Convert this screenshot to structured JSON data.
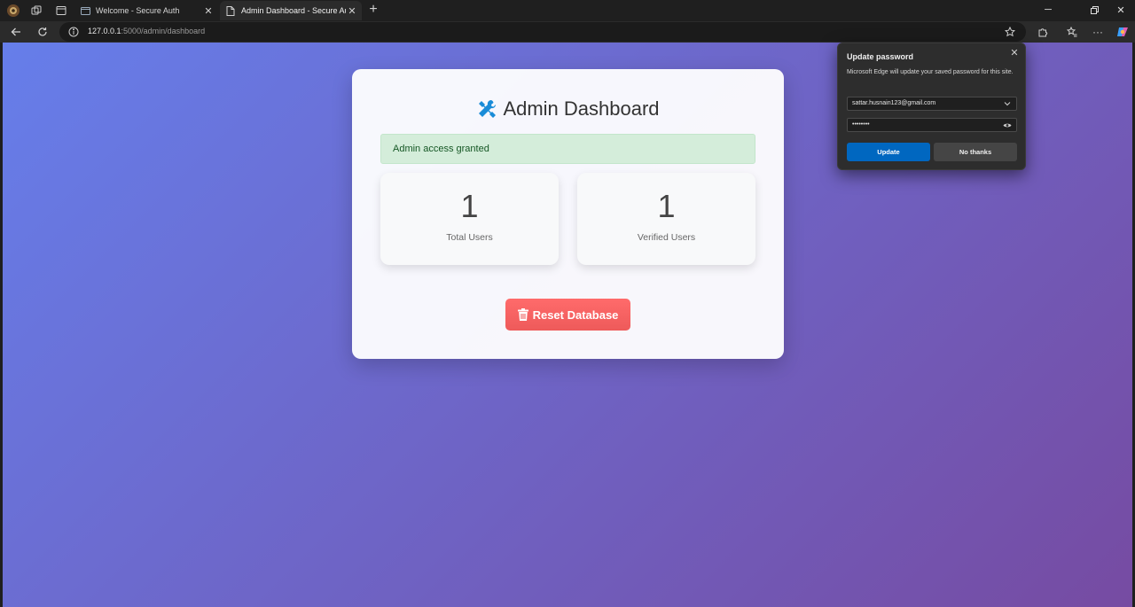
{
  "browser": {
    "tabs": [
      {
        "title": "Welcome - Secure Auth",
        "active": false
      },
      {
        "title": "Admin Dashboard - Secure Auth",
        "active": true
      }
    ],
    "url": {
      "host": "127.0.0.1",
      "rest": ":5000/admin/dashboard"
    }
  },
  "page": {
    "title": "Admin Dashboard",
    "alert": "Admin access granted",
    "stats": [
      {
        "value": "1",
        "label": "Total Users"
      },
      {
        "value": "1",
        "label": "Verified Users"
      }
    ],
    "reset_button": "Reset Database"
  },
  "password_popup": {
    "title": "Update password",
    "description": "Microsoft Edge will update your saved password for this site.",
    "username": "sattar.husnain123@gmail.com",
    "password_mask": "••••••••",
    "update_button": "Update",
    "dismiss_button": "No thanks"
  },
  "colors": {
    "gradient_start": "#667eea",
    "gradient_end": "#764ba2",
    "accent_blue": "#0078d4",
    "danger": "#ee5a5a",
    "success_bg": "#d4edda"
  }
}
